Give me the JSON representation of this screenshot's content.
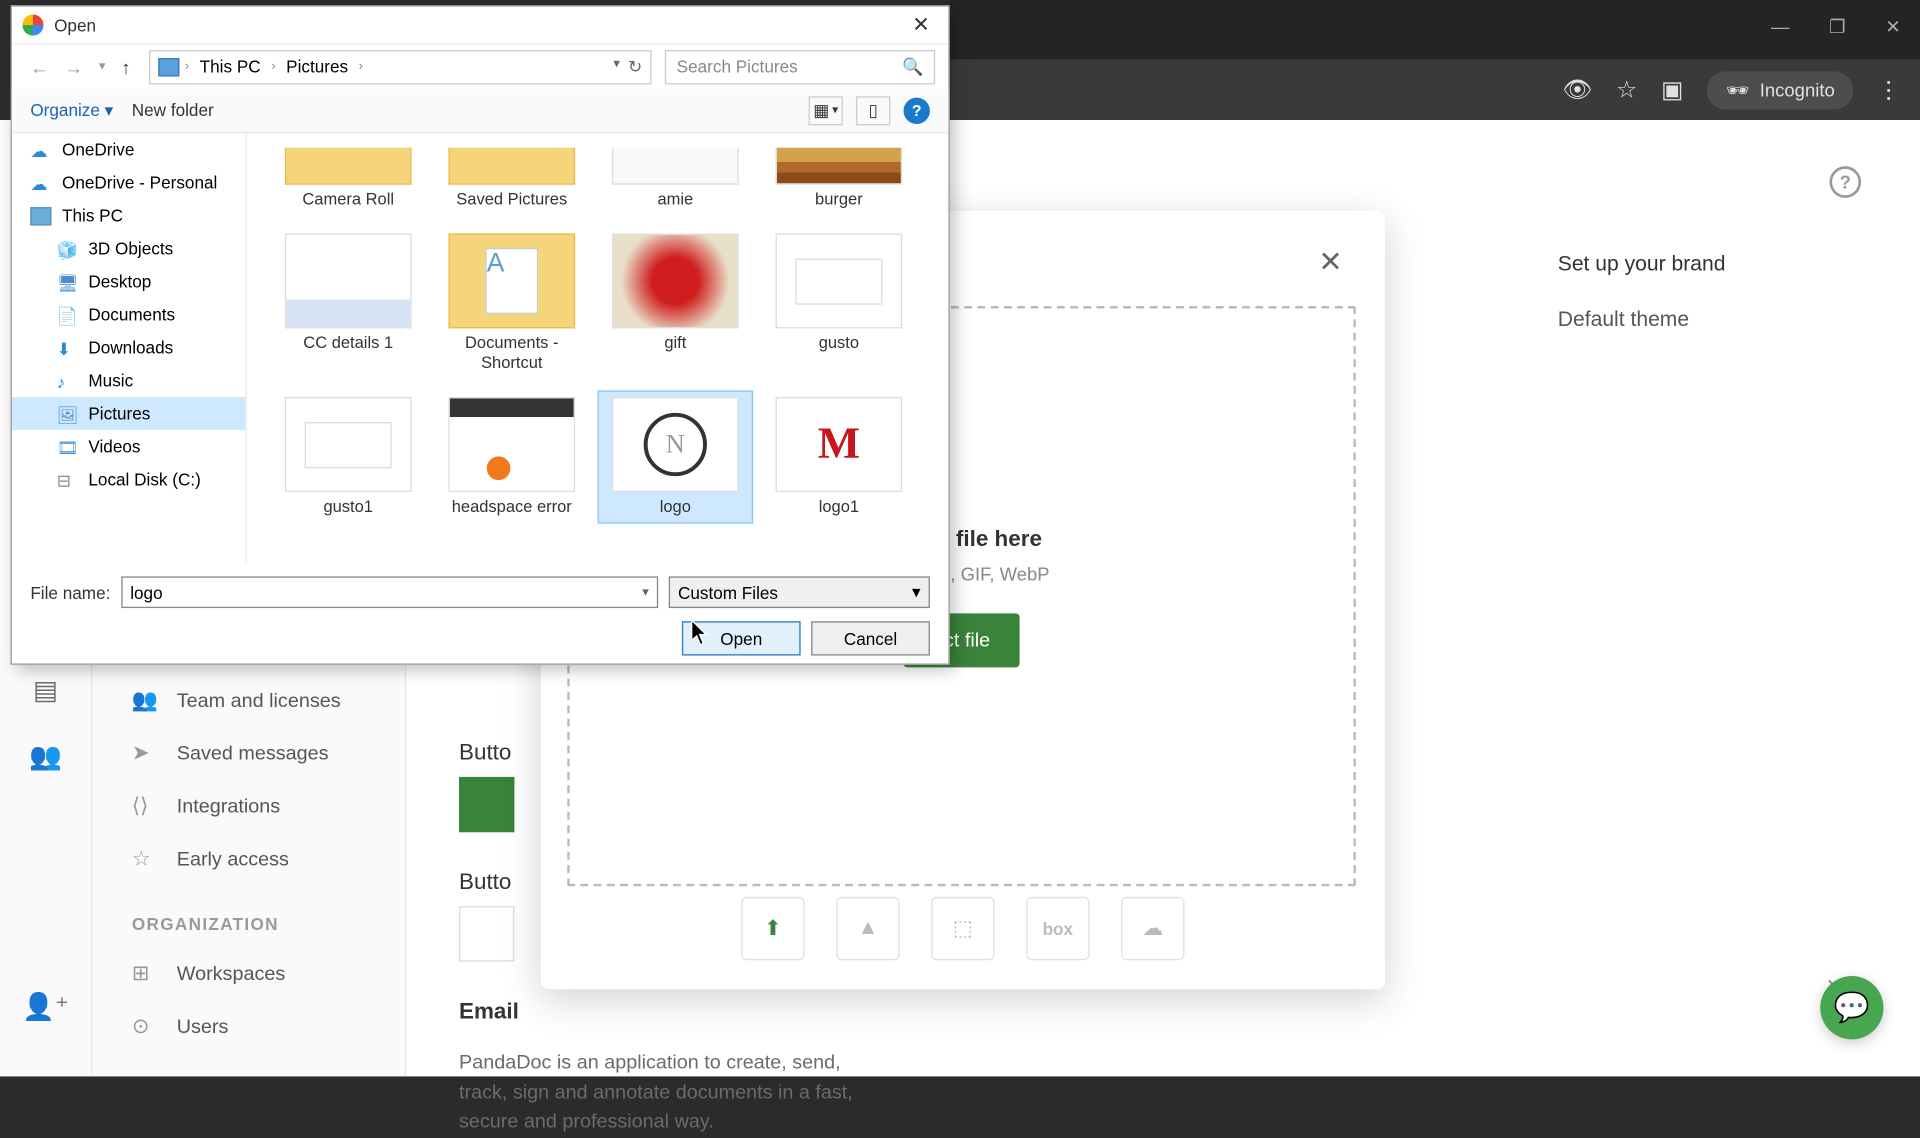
{
  "browser": {
    "incognito_label": "Incognito",
    "win_min": "—",
    "win_max": "❐",
    "win_close": "✕"
  },
  "app": {
    "sidebar": [
      {
        "icon": "👥",
        "label": "Team and licenses"
      },
      {
        "icon": "➤",
        "label": "Saved messages"
      },
      {
        "icon": "⟨⟩",
        "label": "Integrations"
      },
      {
        "icon": "☆",
        "label": "Early access"
      }
    ],
    "org_header": "ORGANIZATION",
    "org_items": [
      {
        "icon": "⊞",
        "label": "Workspaces"
      },
      {
        "icon": "⊙",
        "label": "Users"
      }
    ],
    "section_button": "Butto",
    "section_button2": "Butto",
    "email_label": "Email",
    "email_desc": "PandaDoc is an application to create, send, track, sign and annotate documents in a fast, secure and professional way.",
    "right_panel": [
      "Set up your brand",
      "Default theme"
    ]
  },
  "upload": {
    "drop_title": "p your file here",
    "drop_sub": "PG, PNG, GIF, WebP",
    "select_btn": "ect file"
  },
  "filedialog": {
    "title": "Open",
    "breadcrumb": [
      "This PC",
      "Pictures"
    ],
    "search_placeholder": "Search Pictures",
    "organize": "Organize",
    "new_folder": "New folder",
    "tree": [
      {
        "label": "OneDrive",
        "type": "cloud",
        "root": true
      },
      {
        "label": "OneDrive - Personal",
        "type": "cloud",
        "root": true
      },
      {
        "label": "This PC",
        "type": "pc",
        "root": true
      },
      {
        "label": "3D Objects",
        "type": "3d"
      },
      {
        "label": "Desktop",
        "type": "desktop"
      },
      {
        "label": "Documents",
        "type": "docs"
      },
      {
        "label": "Downloads",
        "type": "downloads"
      },
      {
        "label": "Music",
        "type": "music"
      },
      {
        "label": "Pictures",
        "type": "pictures",
        "selected": true
      },
      {
        "label": "Videos",
        "type": "videos"
      },
      {
        "label": "Local Disk (C:)",
        "type": "disk"
      }
    ],
    "files": [
      {
        "label": "Camera Roll",
        "kind": "folder"
      },
      {
        "label": "Saved Pictures",
        "kind": "folder"
      },
      {
        "label": "amie",
        "kind": "image-blank"
      },
      {
        "label": "burger",
        "kind": "burger"
      },
      {
        "label": "CC details 1",
        "kind": "doc"
      },
      {
        "label": "Documents - Shortcut",
        "kind": "shortcut"
      },
      {
        "label": "gift",
        "kind": "gift"
      },
      {
        "label": "gusto",
        "kind": "gusto"
      },
      {
        "label": "gusto1",
        "kind": "gusto"
      },
      {
        "label": "headspace error",
        "kind": "headspace"
      },
      {
        "label": "logo",
        "kind": "logo",
        "selected": true
      },
      {
        "label": "logo1",
        "kind": "logo1"
      }
    ],
    "filename_label": "File name:",
    "filename_value": "logo",
    "filetype_value": "Custom Files",
    "open_btn": "Open",
    "cancel_btn": "Cancel"
  }
}
